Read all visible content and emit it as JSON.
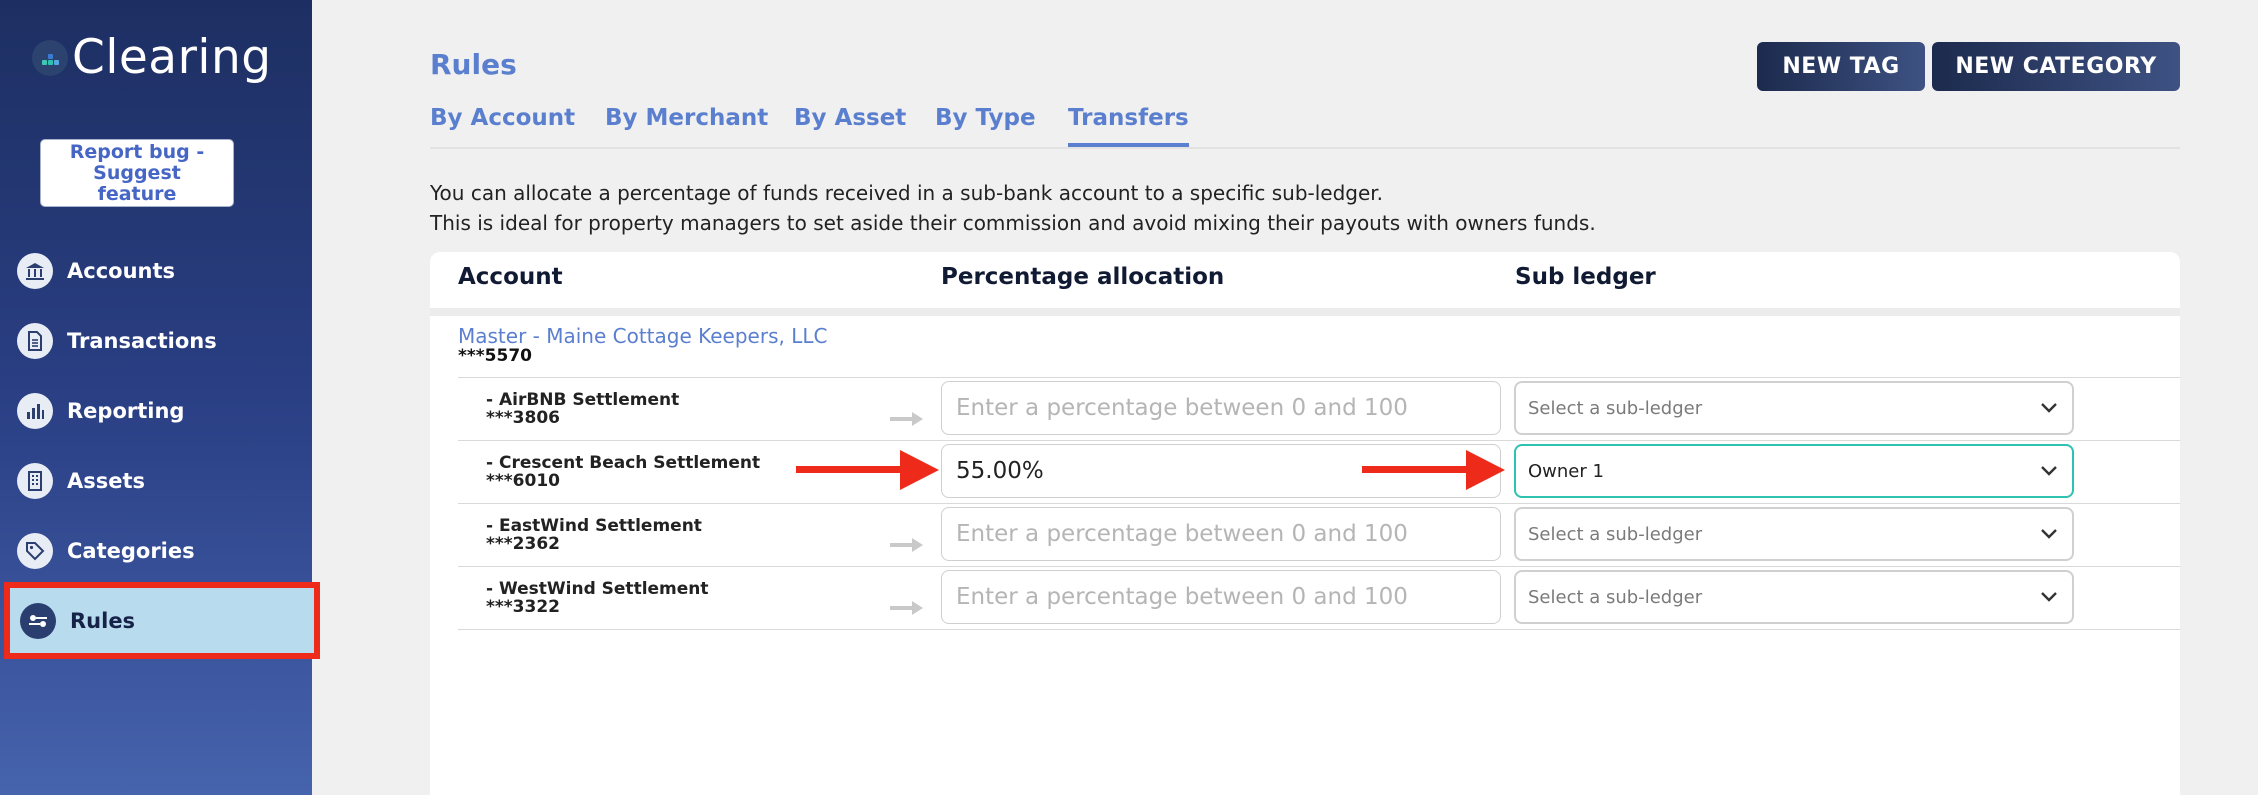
{
  "brand": {
    "name": "Clearing"
  },
  "sidebar": {
    "report_bug": "Report bug - Suggest feature",
    "items": [
      {
        "label": "Accounts",
        "icon": "bank-icon"
      },
      {
        "label": "Transactions",
        "icon": "document-icon"
      },
      {
        "label": "Reporting",
        "icon": "bar-chart-icon"
      },
      {
        "label": "Assets",
        "icon": "building-icon"
      },
      {
        "label": "Categories",
        "icon": "tag-icon"
      },
      {
        "label": "Rules",
        "icon": "rules-icon",
        "active": true
      }
    ]
  },
  "header": {
    "title": "Rules",
    "new_tag": "NEW TAG",
    "new_category": "NEW CATEGORY"
  },
  "tabs": [
    {
      "label": "By Account"
    },
    {
      "label": "By Merchant"
    },
    {
      "label": "By Asset"
    },
    {
      "label": "By Type"
    },
    {
      "label": "Transfers",
      "active": true
    }
  ],
  "description": {
    "line1": "You can allocate a percentage of funds received in a sub-bank account to a specific sub-ledger.",
    "line2": "This is ideal for property managers to set aside their commission and avoid mixing their payouts with owners funds."
  },
  "table": {
    "columns": [
      "Account",
      "Percentage allocation",
      "Sub ledger"
    ],
    "master": {
      "name": "Master - Maine Cottage Keepers, LLC",
      "number": "***5570"
    },
    "placeholder_pct": "Enter a percentage between 0 and 100",
    "placeholder_ledger": "Select a sub-ledger",
    "rows": [
      {
        "name": "- AirBNB Settlement",
        "number": "***3806",
        "percentage": "",
        "subledger": ""
      },
      {
        "name": "- Crescent Beach Settlement",
        "number": "***6010",
        "percentage": "55.00%",
        "subledger": "Owner 1"
      },
      {
        "name": "- EastWind Settlement",
        "number": "***2362",
        "percentage": "",
        "subledger": ""
      },
      {
        "name": "- WestWind Settlement",
        "number": "***3322",
        "percentage": "",
        "subledger": ""
      }
    ]
  },
  "colors": {
    "accent": "#5b7fcf",
    "highlight_red": "#ee2a1a",
    "focus_teal": "#2ec2b1",
    "active_nav_bg": "#b8dcee"
  }
}
